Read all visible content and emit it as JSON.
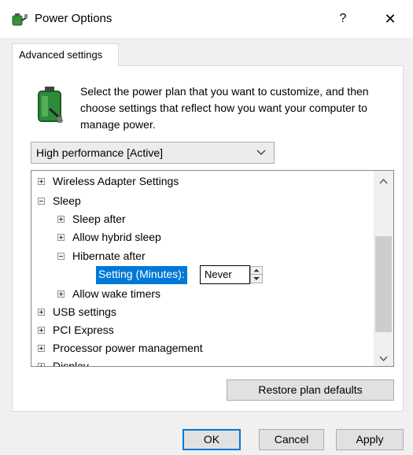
{
  "window": {
    "title": "Power Options",
    "help_glyph": "?",
    "close_glyph": "✕"
  },
  "tab": {
    "label": "Advanced settings"
  },
  "description": "Select the power plan that you want to customize, and then choose settings that reflect how you want your computer to manage power.",
  "plan_select": {
    "selected": "High performance [Active]"
  },
  "tree": {
    "items": [
      {
        "label": "Wireless Adapter Settings",
        "state": "collapsed",
        "level": 0
      },
      {
        "label": "Sleep",
        "state": "expanded",
        "level": 0
      },
      {
        "label": "Sleep after",
        "state": "collapsed",
        "level": 1
      },
      {
        "label": "Allow hybrid sleep",
        "state": "collapsed",
        "level": 1
      },
      {
        "label": "Hibernate after",
        "state": "expanded",
        "level": 1
      },
      {
        "label": "Allow wake timers",
        "state": "collapsed",
        "level": 1
      },
      {
        "label": "USB settings",
        "state": "collapsed",
        "level": 0
      },
      {
        "label": "PCI Express",
        "state": "collapsed",
        "level": 0
      },
      {
        "label": "Processor power management",
        "state": "collapsed",
        "level": 0
      },
      {
        "label": "Display",
        "state": "collapsed",
        "level": 0
      }
    ],
    "setting": {
      "label": "Setting (Minutes):",
      "value": "Never"
    }
  },
  "buttons": {
    "restore": "Restore plan defaults",
    "ok": "OK",
    "cancel": "Cancel",
    "apply": "Apply"
  },
  "colors": {
    "selection": "#0078d7",
    "window_bg": "#f0f0f0",
    "panel_bg": "#ffffff"
  },
  "icons": {
    "app": "battery-plug-icon",
    "plan": "battery-plug-icon"
  }
}
